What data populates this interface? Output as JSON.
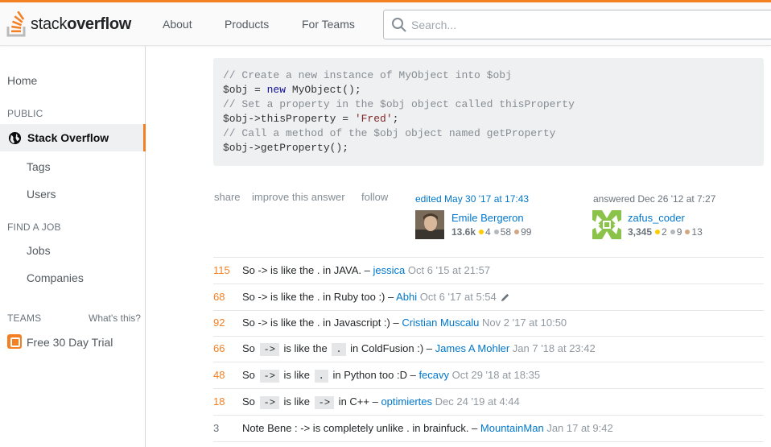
{
  "header": {
    "logo_plain": "stack",
    "logo_bold": "overflow",
    "nav": [
      "About",
      "Products",
      "For Teams"
    ],
    "search_placeholder": "Search..."
  },
  "sidebar": {
    "home": "Home",
    "public_heading": "PUBLIC",
    "active_item": "Stack Overflow",
    "tags": "Tags",
    "users": "Users",
    "job_heading": "FIND A JOB",
    "jobs": "Jobs",
    "companies": "Companies",
    "teams_heading": "TEAMS",
    "whats_this": "What's this?",
    "trial": "Free 30 Day Trial"
  },
  "code_lines": [
    "// Create a new instance of MyObject into $obj",
    "$obj = new MyObject();",
    "// Set a property in the $obj object called thisProperty",
    "$obj->thisProperty = 'Fred';",
    "// Call a method of the $obj object named getProperty",
    "$obj->getProperty();"
  ],
  "post_menu": {
    "share": "share",
    "improve": "improve this answer",
    "follow": "follow"
  },
  "editor": {
    "action": "edited May 30 '17 at 17:43",
    "name": "Emile Bergeron",
    "rep": "13.6k",
    "gold": "4",
    "silver": "58",
    "bronze": "99"
  },
  "answerer": {
    "action": "answered Dec 26 '12 at 7:27",
    "name": "zafus_coder",
    "rep": "3,345",
    "gold": "2",
    "silver": "9",
    "bronze": "13"
  },
  "comments": [
    {
      "score": "115",
      "hot": true,
      "parts": [
        {
          "t": "So -> is like the . in JAVA. – "
        }
      ],
      "user": "jessica",
      "date": "Oct 6 '15 at 21:57",
      "edited": false
    },
    {
      "score": "68",
      "hot": true,
      "parts": [
        {
          "t": "So -> is like the . in Ruby too :) – "
        }
      ],
      "user": "Abhi",
      "date": "Oct 6 '17 at 5:54",
      "edited": true
    },
    {
      "score": "92",
      "hot": true,
      "parts": [
        {
          "t": "So -> is like the . in Javascript :) – "
        }
      ],
      "user": "Cristian Muscalu",
      "date": "Nov 2 '17 at 10:50",
      "edited": false
    },
    {
      "score": "66",
      "hot": true,
      "parts": [
        {
          "t": "So "
        },
        {
          "c": "->"
        },
        {
          "t": " is like the "
        },
        {
          "c": "."
        },
        {
          "t": " in ColdFusion :) – "
        }
      ],
      "user": "James A Mohler",
      "date": "Jan 7 '18 at 23:42",
      "edited": false
    },
    {
      "score": "48",
      "hot": true,
      "parts": [
        {
          "t": "So "
        },
        {
          "c": "->"
        },
        {
          "t": " is like "
        },
        {
          "c": "."
        },
        {
          "t": " in Python too :D – "
        }
      ],
      "user": "fecavy",
      "date": "Oct 29 '18 at 18:35",
      "edited": false
    },
    {
      "score": "18",
      "hot": true,
      "parts": [
        {
          "t": "So "
        },
        {
          "c": "->"
        },
        {
          "t": " is like "
        },
        {
          "c": "->"
        },
        {
          "t": " in C++ – "
        }
      ],
      "user": "optimiertes",
      "date": "Dec 24 '19 at 4:44",
      "edited": false
    },
    {
      "score": "3",
      "hot": false,
      "parts": [
        {
          "t": "Note Bene : -> is completely unlike . in brainfuck. – "
        }
      ],
      "user": "MountainMan",
      "date": "Jan 17 at 9:42",
      "edited": false
    }
  ],
  "colors": {
    "accent": "#f48024",
    "link": "#0077cc",
    "score_hot": "#f48024",
    "score_normal": "#6a737c"
  }
}
